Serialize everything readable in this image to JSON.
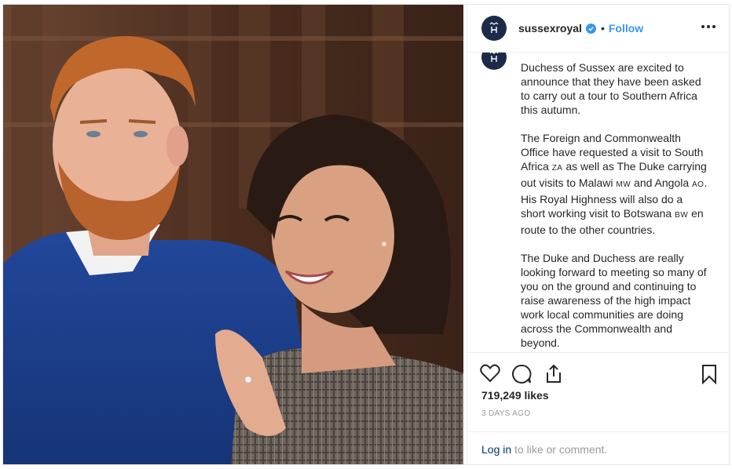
{
  "header": {
    "username": "sussexroyal",
    "separator": "•",
    "follow_label": "Follow",
    "avatar_icon": "royal-monogram-icon",
    "verified_icon": "verified-badge-icon",
    "more_icon": "more-options-icon"
  },
  "caption": {
    "line_1": "Duchess of Sussex are excited to announce that they have been asked to carry out a tour to Southern Africa this autumn.",
    "p2_a": "The Foreign and Commonwealth Office have requested a visit to South Africa ",
    "p2_za": "ZA",
    "p2_b": " as well as The Duke carrying out visits to Malawi ",
    "p2_mw": "MW",
    "p2_c": " and Angola ",
    "p2_ao": "AO",
    "p2_d": ". His Royal Highness will also do a short working visit to Botswana ",
    "p2_bw": "BW",
    "p2_e": " en route to the other countries.",
    "p3": "The Duke and Duchess are really looking forward to meeting so many of you on the ground and continuing to raise awareness of the high impact work local communities are doing across the Commonwealth and beyond."
  },
  "actions": {
    "like_icon": "heart-icon",
    "comment_icon": "comment-icon",
    "share_icon": "share-icon",
    "save_icon": "bookmark-icon",
    "likes": "719,249 likes",
    "timestamp": "3 DAYS AGO"
  },
  "login": {
    "link_label": "Log in",
    "suffix": " to like or comment."
  },
  "colors": {
    "accent": "#3897f0",
    "link_dark": "#003569",
    "text": "#262626",
    "muted": "#999999",
    "avatar_bg": "#1c2a4a"
  }
}
